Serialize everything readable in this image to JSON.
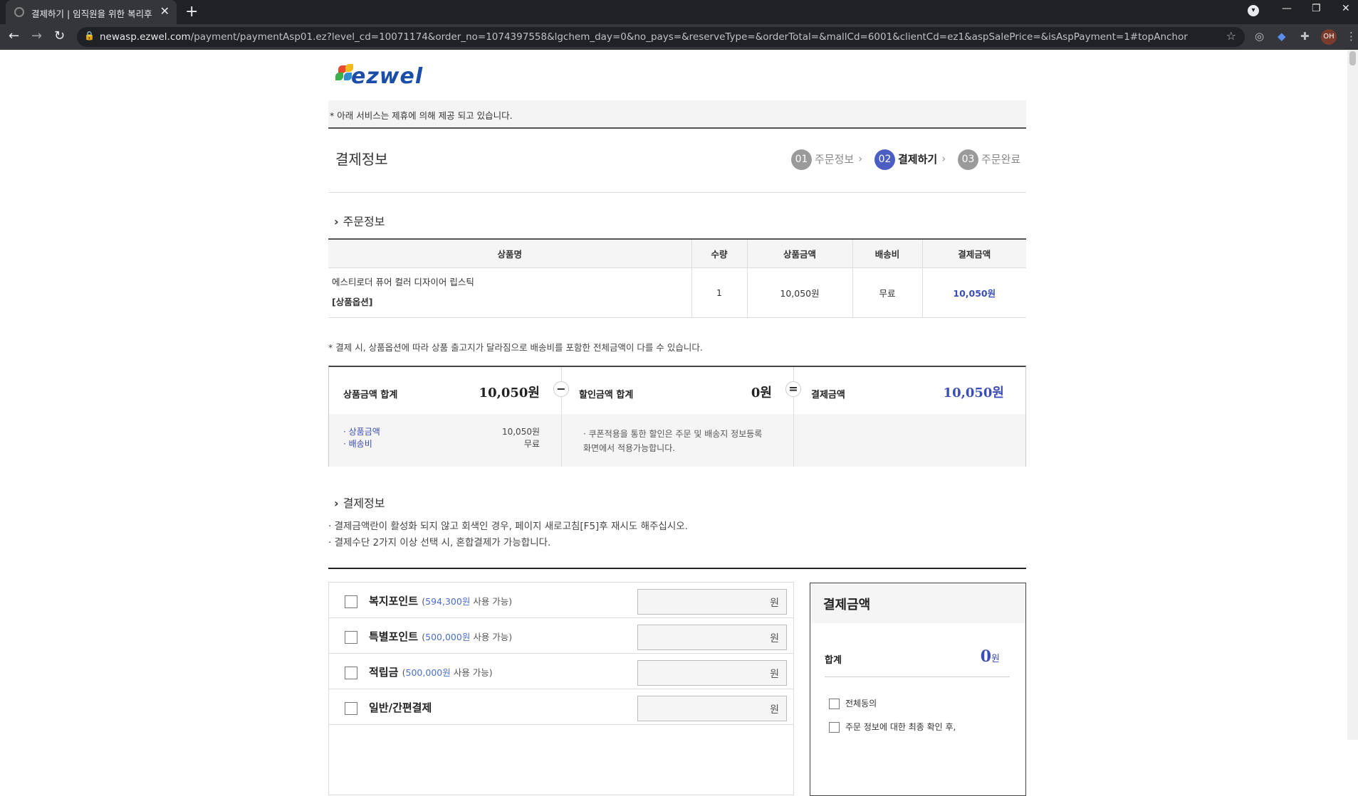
{
  "browser": {
    "tab_title": "결제하기 | 임직원을 위한 복리후",
    "url_host": "newasp.ezwel.com",
    "url_path": "/payment/paymentAsp01.ez?level_cd=10071174&order_no=1074397558&lgchem_day=0&no_pays=&reserveType=&orderTotal=&mallCd=6001&clientCd=ez1&aspSalePrice=&isAspPayment=1#topAnchor",
    "profile_initials": "OH"
  },
  "logo": {
    "text": "ezwel"
  },
  "notice": "* 아래 서비스는 제휴에 의해 제공 되고 있습니다.",
  "section_title": "결제정보",
  "steps": [
    {
      "num": "01",
      "label": "주문정보",
      "active": false
    },
    {
      "num": "02",
      "label": "결제하기",
      "active": true
    },
    {
      "num": "03",
      "label": "주문완료",
      "active": false
    }
  ],
  "order": {
    "heading": "주문정보",
    "columns": [
      "상품명",
      "수량",
      "상품금액",
      "배송비",
      "결제금액"
    ],
    "row": {
      "name": "에스티로더 퓨어 컬러 디자이어 립스틱",
      "option": "[상품옵션]",
      "qty": "1",
      "price": "10,050원",
      "shipping": "무료",
      "pay": "10,050원"
    },
    "note": "* 결제 시, 상품옵션에 따라 상품 출고지가 달라짐으로 배송비를 포함한 전체금액이 다를 수 있습니다."
  },
  "summary": {
    "product_total_label": "상품금액 합계",
    "product_total": "10,050원",
    "minus": "−",
    "discount_label": "할인금액 합계",
    "discount": "0원",
    "equals": "=",
    "pay_label": "결제금액",
    "pay_amount": "10,050원",
    "detail_price_label": "· 상품금액",
    "detail_price": "10,050원",
    "detail_ship_label": "· 배송비",
    "detail_ship": "무료",
    "discount_memo": "· 쿠폰적용을 통한 할인은 주문 및 배송지 정보등록화면에서 적용가능합니다."
  },
  "payinfo": {
    "heading": "결제정보",
    "guide1": "· 결제금액란이 활성화 되지 않고 회색인 경우, 페이지 새로고침[F5]후 재시도 해주십시오.",
    "guide2": "· 결제수단 2가지 이상 선택 시, 혼합결제가 가능합니다.",
    "methods": [
      {
        "name": "복지포인트",
        "amount": "594,300원",
        "avail": "사용 가능)",
        "unit": "원"
      },
      {
        "name": "특별포인트",
        "amount": "500,000원",
        "avail": "사용 가능)",
        "unit": "원"
      },
      {
        "name": "적립금",
        "amount": "500,000원",
        "avail": "사용 가능)",
        "unit": "원"
      },
      {
        "name": "일반/간편결제",
        "amount": "",
        "avail": "",
        "unit": "원"
      }
    ]
  },
  "paybox": {
    "title": "결제금액",
    "total_label": "합계",
    "total_value": "0",
    "total_unit": "원",
    "agree_all": "전체동의",
    "agree_confirm": "주문 정보에 대한 최종 확인 후,"
  }
}
